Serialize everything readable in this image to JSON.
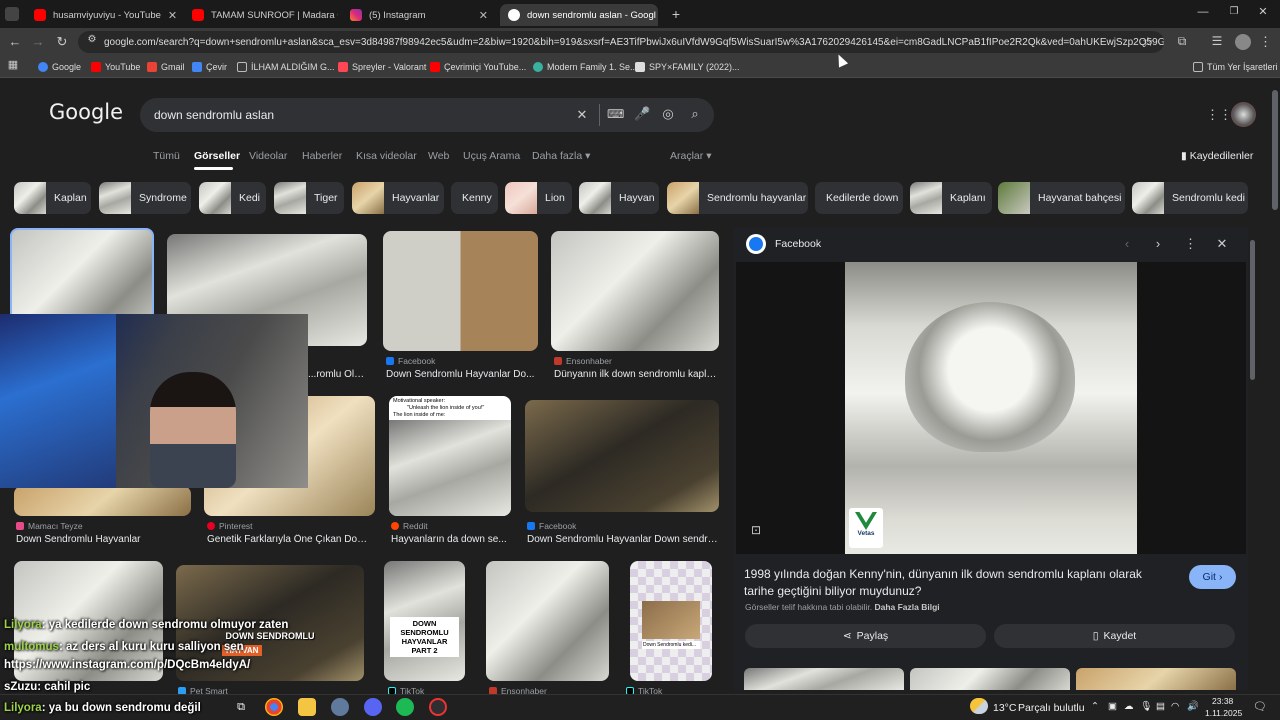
{
  "browser": {
    "tabs": [
      {
        "title": "husamviyuviyu - YouTube",
        "color": "#ff0000"
      },
      {
        "title": "TAMAM SUNROOF | Madara Of",
        "color": "#ff0000"
      },
      {
        "title": "(5) Instagram",
        "color": "#e1306c"
      },
      {
        "title": "down sendromlu aslan - Googl",
        "color": "#4285f4"
      }
    ],
    "new_tab": "+",
    "url": "google.com/search?q=down+sendromlu+aslan&sca_esv=3d84987f98942ec5&udm=2&biw=1920&bih=919&sxsrf=AE3TifPbwiJx6uIVfdW9Gqf5WisSuarI5w%3A1762029426145&ei=cm8GadLNCPaB1fIPoe2R2Qk&ved=0ahUKEwjSzp2Q59GQAxX2QFU...",
    "window_controls": {
      "minimize": "—",
      "restore": "❐",
      "close": "✕"
    }
  },
  "bookmarks": {
    "items": [
      {
        "label": "Google",
        "color": "#4285f4"
      },
      {
        "label": "YouTube",
        "color": "#ff0000"
      },
      {
        "label": "Gmail",
        "color": "#ea4335"
      },
      {
        "label": "Çevir",
        "color": "#4285f4"
      },
      {
        "label": "İLHAM ALDIĞIM G...",
        "color": "#bbbbbb"
      },
      {
        "label": "Spreyler - Valorant",
        "color": "#ff4655"
      },
      {
        "label": "Çevrimiçi YouTube...",
        "color": "#ff0000"
      },
      {
        "label": "Modern Family 1. Se...",
        "color": "#3ab0a0"
      },
      {
        "label": "SPY×FAMILY (2022)...",
        "color": "#dddddd"
      }
    ],
    "all_bookmarks": "Tüm Yer İşaretleri"
  },
  "google": {
    "logo": "Google",
    "query": "down sendromlu aslan",
    "nav_tabs": [
      "Tümü",
      "Görseller",
      "Videolar",
      "Haberler",
      "Kısa videolar",
      "Web",
      "Uçuş Arama",
      "Daha fazla"
    ],
    "tools": "Araçlar",
    "saved": "Kaydedilenler",
    "chips": [
      "Kaplan",
      "Syndrome",
      "Kedi",
      "Tiger",
      "Hayvanlar",
      "Kenny",
      "Lion",
      "Hayvan",
      "Sendromlu hayvanlar",
      "Kedilerde down",
      "Kaplanı",
      "Hayvanat bahçesi",
      "Sendromlu kedi"
    ]
  },
  "results": [
    {
      "source": "",
      "caption": "...romlu Olab..."
    },
    {
      "source": "Facebook",
      "caption": "Down Sendromlu Hayvanlar Do..."
    },
    {
      "source": "Ensonhaber",
      "caption": "Dünyanın ilk down sendromlu kaplanı"
    },
    {
      "source": "Mamacı Teyze",
      "caption": "Down Sendromlu Hayvanlar"
    },
    {
      "source": "Pinterest",
      "caption": "Genetik Farklarıyla Öne Çıkan Dow..."
    },
    {
      "source": "Reddit",
      "caption": "Hayvanların da down se..."
    },
    {
      "source": "Facebook",
      "caption": "Down Sendromlu Hayvanlar Down sendro..."
    },
    {
      "source": "Pet Smart",
      "caption": ""
    },
    {
      "source": "TikTok",
      "caption": ""
    },
    {
      "source": "Ensonhaber",
      "caption": ""
    },
    {
      "source": "TikTok",
      "caption": ""
    }
  ],
  "image_texts": {
    "meme_line1": "Motivational speaker:",
    "meme_line2": "\"Unleash the lion inside of you!\"",
    "meme_line3": "The lion inside of me:",
    "bear_overlay_1": "DOWN SENDROMLU",
    "bear_overlay_2": "HAYVAN",
    "tiktok_overlay": "DOWN SENDROMLU HAYVANLAR PART 2",
    "cat_caption": "Down Sendromlu kedi..."
  },
  "panel": {
    "source": "Facebook",
    "watermark": "Vetas",
    "title": "1998 yılında doğan Kenny'nin, dünyanın ilk down sendromlu kaplanı olarak tarihe geçtiğini biliyor muydunuz?",
    "visit": "Git",
    "copyright": "Görseller telif hakkına tabi olabilir.",
    "more_info": "Daha Fazla Bilgi",
    "share": "Paylaş",
    "save": "Kaydet"
  },
  "chat": [
    {
      "user": "Lilyora",
      "msg": ": ya kedilerde down sendromu olmuyor zaten"
    },
    {
      "user": "multomus",
      "msg": ": az ders al kuru kuru salliyon sen"
    },
    {
      "user": "",
      "msg": "https://www.instagram.com/p/DQcBm4eldyA/"
    },
    {
      "user": "sZuzu",
      "msg": ": cahil pic"
    },
    {
      "user": "Lilyora",
      "msg": ": ya bu down sendromu değil"
    }
  ],
  "taskbar": {
    "weather": "13°C",
    "weather_desc": "Parçalı bulutlu",
    "time": "23:38",
    "date": "1.11.2025"
  },
  "colors": {
    "accent": "#8ab4f8",
    "chip_bg": "#303134",
    "page_bg": "#1f1f1f"
  }
}
